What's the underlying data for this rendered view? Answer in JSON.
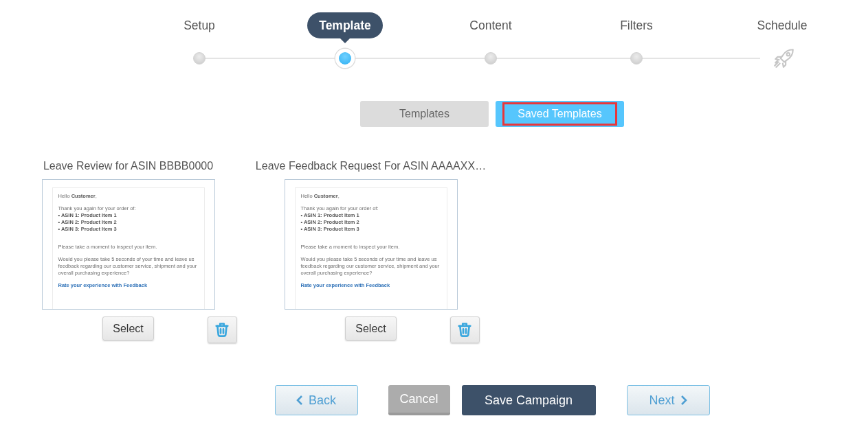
{
  "steps": [
    {
      "label": "Setup",
      "kind": "dot",
      "selected": false
    },
    {
      "label": "Template",
      "kind": "dot",
      "selected": true
    },
    {
      "label": "Content",
      "kind": "dot",
      "selected": false
    },
    {
      "label": "Filters",
      "kind": "dot",
      "selected": false
    },
    {
      "label": "Schedule",
      "kind": "rocket",
      "selected": false
    }
  ],
  "template_tabs": [
    {
      "label": "Templates",
      "selected": false,
      "highlighted": false
    },
    {
      "label": "Saved Templates",
      "selected": true,
      "highlighted": true
    }
  ],
  "saved_templates": [
    {
      "title": "Leave Review for ASIN BBBB0000",
      "preview": {
        "greeting": "Hello **Customer**,",
        "intro": "Thank you again for your order of:",
        "items": [
          "• ASIN 1: Product Item 1",
          "• ASIN 2: Product Item 2",
          "• ASIN 3: Product Item 3"
        ],
        "note": "Please take a moment to inspect your item.",
        "request": "Would you please take 5 seconds of your time and leave us feedback regarding our customer service, shipment and your overall purchasing experience?",
        "link": "Rate your experience with Feedback"
      },
      "select_button": "Select"
    },
    {
      "title": "Leave Feedback Request For ASIN AAAAXX…",
      "preview": {
        "greeting": "Hello **Customer**,",
        "intro": "Thank you again for your order of:",
        "items": [
          "• ASIN 1: Product Item 1",
          "• ASIN 2: Product Item 2",
          "• ASIN 3: Product Item 3"
        ],
        "note": "Please take a moment to inspect your item.",
        "request": "Would you please take 5 seconds of your time and leave us feedback regarding our customer service, shipment and your overall purchasing experience?",
        "link": "Rate your experience with Feedback"
      },
      "select_button": "Select"
    }
  ],
  "actions": [
    {
      "kind": "back",
      "label": "Back"
    },
    {
      "kind": "cancel",
      "label": "Cancel"
    },
    {
      "kind": "primary",
      "label": "Save Campaign"
    },
    {
      "kind": "next",
      "label": "Next"
    }
  ]
}
